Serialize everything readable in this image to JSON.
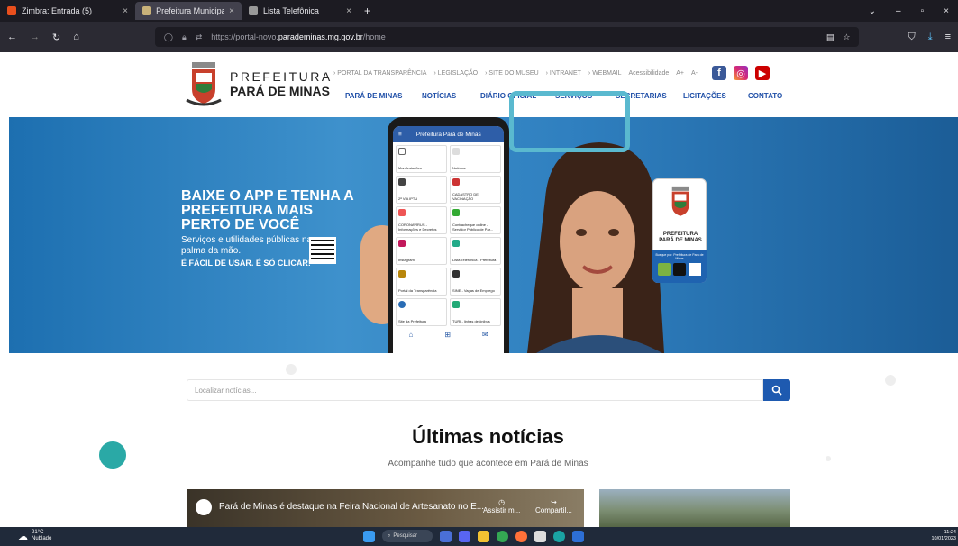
{
  "browser": {
    "tabs": [
      {
        "label": "Zimbra: Entrada (5)",
        "active": false
      },
      {
        "label": "Prefeitura Municipal de Pará de",
        "active": true
      },
      {
        "label": "Lista Telefônica",
        "active": false
      }
    ],
    "new_tab": "+",
    "url_prefix": "https://portal-novo.",
    "url_domain": "parademinas.mg.gov.br",
    "url_path": "/home"
  },
  "site": {
    "logo_line1": "PREFEITURA",
    "logo_line2": "PARÁ DE MINAS",
    "top_links": [
      "PORTAL DA TRANSPARÊNCIA",
      "LEGISLAÇÃO",
      "SITE DO MUSEU",
      "INTRANET",
      "WEBMAIL"
    ],
    "accessibility": "Acessibilidade",
    "font_increase": "A+",
    "font_decrease": "A-",
    "nav": [
      "PARÁ DE MINAS",
      "NOTÍCIAS",
      "DIÁRIO OFICIAL",
      "SERVIÇOS",
      "SECRETARIAS",
      "LICITAÇÕES",
      "CONTATO"
    ]
  },
  "banner": {
    "title": "BAIXE O APP E TENHA A PREFEITURA MAIS PERTO DE VOCÊ",
    "subtitle": "Serviços e utilidades públicas na palma da mão.",
    "emphasis": "É FÁCIL DE USAR. É SÓ CLICAR!",
    "phone_header": "Prefeitura Pará de Minas",
    "phone_items": [
      "Manifestações",
      "Notícias",
      "2ª VIA IPTU",
      "CADASTRO DE VACINAÇÃO",
      "CORONAVÍRUS - Informações e Decretos",
      "Contracheque online - Servidor Público de Par...",
      "Instagram",
      "Lista Telefônica - Prefeitura",
      "Portal da Transparência",
      "SINE - Vagas de Emprego",
      "Site da Prefeitura",
      "TURI - linhas de ônibus"
    ],
    "card_line1": "PREFEITURA",
    "card_line2": "PARÁ DE MINAS",
    "store_text": "Busque por: Prefeitura de Pará de Minas"
  },
  "search": {
    "placeholder": "Localizar notícias..."
  },
  "news": {
    "title": "Últimas notícias",
    "subtitle": "Acompanhe tudo que acontece em Pará de Minas",
    "video_title": "Pará de Minas é destaque na Feira Nacional de Artesanato no E...",
    "watch_label": "Assistir m...",
    "share_label": "Compartil..."
  },
  "taskbar": {
    "temp": "21°C",
    "weather": "Nublado",
    "search": "Pesquisar",
    "time": "11:24",
    "date": "10/01/2023"
  },
  "colors": {
    "nav_blue": "#1e4ea7",
    "highlight": "#5ab9cf",
    "teal_dot": "#2aa9a6"
  }
}
